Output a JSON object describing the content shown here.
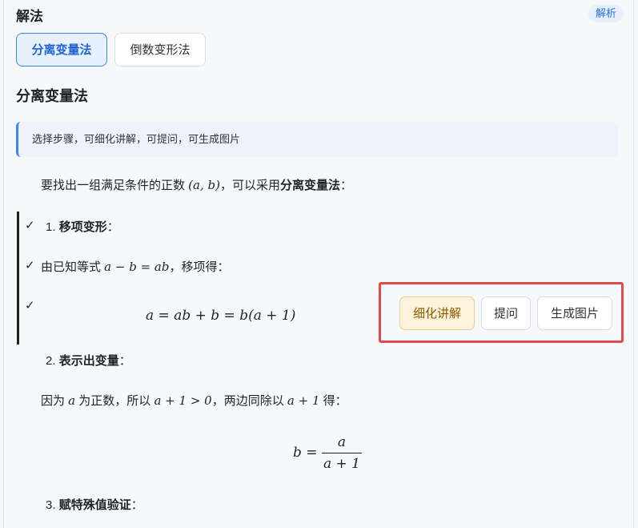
{
  "header": {
    "title": "解法",
    "badge": "解析"
  },
  "methods": [
    {
      "label": "分离变量法"
    },
    {
      "label": "倒数变形法"
    }
  ],
  "section": {
    "title": "分离变量法"
  },
  "tip": "选择步骤，可细化讲解，可提问，可生成图片",
  "intro": {
    "pre": "要找出一组满足条件的正数 ",
    "math": "(a, b)",
    "mid": "，可以采用",
    "bold": "分离变量法",
    "post": "："
  },
  "steps": {
    "check_mark": "✓",
    "step1": {
      "num": "1. ",
      "title": "移项变形",
      "colon": "："
    },
    "step1_line": {
      "pre": "由已知等式 ",
      "math": "a − b = ab",
      "post": "，移项得："
    },
    "step1_eq": "a = ab + b = b(a + 1)",
    "step2": {
      "num": "2. ",
      "title": "表示出变量",
      "colon": "："
    },
    "step2_line": {
      "p1": "因为 ",
      "m1": "a",
      "p2": " 为正数，所以 ",
      "m2": "a + 1 > 0",
      "p3": "，两边同除以 ",
      "m3": "a + 1",
      "p4": " 得："
    },
    "step2_eq": {
      "lhs": "b =",
      "num": "a",
      "den": "a + 1"
    },
    "step3": {
      "num": "3. ",
      "title": "赋特殊值验证",
      "colon": "："
    }
  },
  "actions": {
    "explain": "细化讲解",
    "ask": "提问",
    "image": "生成图片"
  }
}
